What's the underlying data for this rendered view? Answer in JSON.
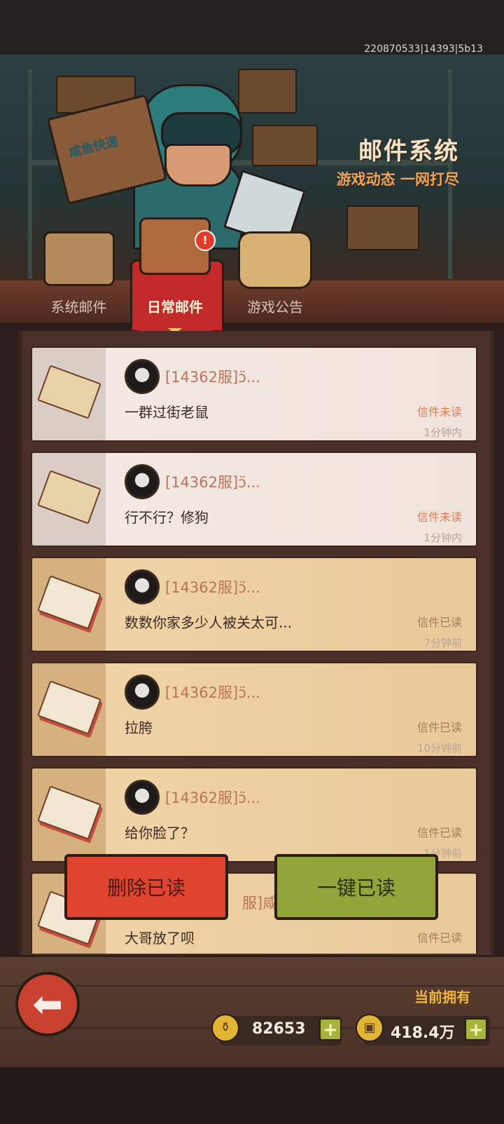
{
  "version": "220870533|14393|5b13",
  "banner": {
    "title": "邮件系统",
    "subtitle": "游戏动态 一网打尽",
    "box_label": "咸鱼快递"
  },
  "tabs": [
    {
      "label": "系统邮件",
      "active": false,
      "icon": "suitcase-icon"
    },
    {
      "label": "日常邮件",
      "active": true,
      "icon": "mail-crate-icon",
      "badge": "!"
    },
    {
      "label": "游戏公告",
      "active": false,
      "icon": "radio-icon"
    }
  ],
  "mails": [
    {
      "sender": "[14362服]ↄ̈...",
      "subject": "一群过街老鼠",
      "status": "信件未读",
      "time": "1分钟内",
      "read": false
    },
    {
      "sender": "[14362服]ↄ̈...",
      "subject": "行不行？修狗",
      "status": "信件未读",
      "time": "1分钟内",
      "read": false
    },
    {
      "sender": "[14362服]ↄ̈...",
      "subject": "数数你家多少人被关太可...",
      "status": "信件已读",
      "time": "7分钟前",
      "read": true
    },
    {
      "sender": "[14362服]ↄ̈...",
      "subject": "拉胯",
      "status": "信件已读",
      "time": "10分钟前",
      "read": true
    },
    {
      "sender": "[14362服]ↄ̈...",
      "subject": "给你脸了？",
      "status": "信件已读",
      "time": "1分钟前",
      "read": true
    },
    {
      "sender": "服]咸鱼",
      "subject": "大哥放了呗",
      "status": "信件已读",
      "time": "",
      "read": true
    }
  ],
  "actions": {
    "delete_read": "删除已读",
    "mark_all_read": "一键已读"
  },
  "footer": {
    "owned_label": "当前拥有",
    "currency1": {
      "value": "82653",
      "icon": "gold-bone-icon"
    },
    "currency2": {
      "value": "418.4万",
      "icon": "coin-icon"
    }
  },
  "colors": {
    "active_tab": "#c1292a",
    "unread_status": "#e07c4f",
    "delete_button": "#de4430",
    "read_all_button": "#93a43b",
    "owned_label": "#f0b53a"
  }
}
